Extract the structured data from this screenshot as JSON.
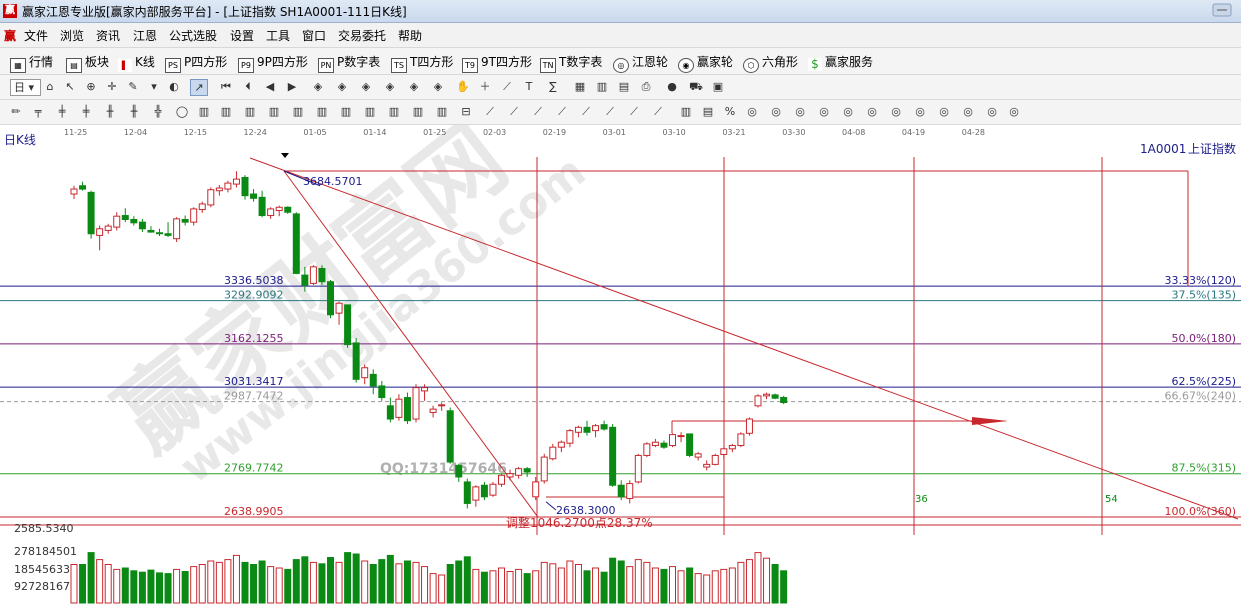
{
  "window": {
    "title": "赢家江恩专业版[赢家内部服务平台] - [上证指数  SH1A0001-111日K线]",
    "app_icon": "赢"
  },
  "menu": [
    "文件",
    "浏览",
    "资讯",
    "江恩",
    "公式选股",
    "设置",
    "工具",
    "窗口",
    "交易委托",
    "帮助"
  ],
  "menu_logo": "赢",
  "toolbar": [
    "行情",
    "板块",
    "K线",
    "P四方形",
    "9P四方形",
    "P数字表",
    "T四方形",
    "9T四方形",
    "T数字表",
    "江恩轮",
    "赢家轮",
    "六角形",
    "赢家服务"
  ],
  "toolbar2_period": "日",
  "chart": {
    "period_label": "日K线",
    "symbol": "1A0001",
    "name": "上证指数",
    "date_ticks": [
      {
        "label": "11-25",
        "i": 0
      },
      {
        "label": "12-04",
        "i": 7
      },
      {
        "label": "12-15",
        "i": 14
      },
      {
        "label": "12-24",
        "i": 21
      },
      {
        "label": "01-05",
        "i": 28
      },
      {
        "label": "01-14",
        "i": 35
      },
      {
        "label": "01-25",
        "i": 42
      },
      {
        "label": "02-03",
        "i": 49
      },
      {
        "label": "02-19",
        "i": 56
      },
      {
        "label": "03-01",
        "i": 63
      },
      {
        "label": "03-10",
        "i": 70
      },
      {
        "label": "03-21",
        "i": 77
      },
      {
        "label": "03-30",
        "i": 84
      },
      {
        "label": "04-08",
        "i": 91
      },
      {
        "label": "04-19",
        "i": 98
      },
      {
        "label": "04-28",
        "i": 105
      }
    ],
    "high_label": "3684.5701",
    "low_label": "2638.3000",
    "retrace_note": "调整1046.2700点28.37%",
    "fib_levels": [
      {
        "price": 3684.5701,
        "left": "",
        "right": "",
        "color": "#c8282d"
      },
      {
        "price": 3336.5038,
        "left": "3336.5038",
        "right": "33.33%(120)",
        "color": "#1c1c8c"
      },
      {
        "price": 3292.9092,
        "left": "3292.9092",
        "right": "37.5%(135)",
        "color": "#2a7a80"
      },
      {
        "price": 3162.1255,
        "left": "3162.1255",
        "right": "50.0%(180)",
        "color": "#7a1f7a"
      },
      {
        "price": 3031.3417,
        "left": "3031.3417",
        "right": "62.5%(225)",
        "color": "#1c1c8c"
      },
      {
        "price": 2987.7472,
        "left": "2987.7472",
        "right": "66.67%(240)",
        "color": "#9a9a9a"
      },
      {
        "price": 2769.7742,
        "left": "2769.7742",
        "right": "87.5%(315)",
        "color": "#2fa02f"
      },
      {
        "price": 2638.9905,
        "left": "2638.9905",
        "right": "100.0%(360)",
        "color": "#c8282d"
      }
    ],
    "time_cycle_labels": [
      "36",
      "54"
    ],
    "volume_labels": [
      "2585.5340",
      "278184501",
      "185456334",
      "92728167"
    ],
    "watermark_main": "赢家财富网",
    "watermark_url": "www.jingjia360.com",
    "watermark_qq": "QQ:1731457646",
    "colors": {
      "up": "#c8282d",
      "down": "#0a8a14",
      "grid": "#c8282d"
    }
  },
  "chart_data": {
    "type": "candlestick",
    "title": "上证指数 SH1A0001 日K线",
    "ylim": [
      2585,
      3720
    ],
    "candles": [
      [
        3615,
        3640,
        3600,
        3630
      ],
      [
        3640,
        3652,
        3625,
        3630
      ],
      [
        3620,
        3625,
        3480,
        3495
      ],
      [
        3490,
        3520,
        3445,
        3510
      ],
      [
        3505,
        3525,
        3495,
        3518
      ],
      [
        3515,
        3560,
        3505,
        3548
      ],
      [
        3550,
        3572,
        3530,
        3538
      ],
      [
        3538,
        3548,
        3520,
        3528
      ],
      [
        3530,
        3540,
        3500,
        3510
      ],
      [
        3505,
        3518,
        3498,
        3500
      ],
      [
        3498,
        3510,
        3488,
        3495
      ],
      [
        3495,
        3530,
        3485,
        3490
      ],
      [
        3480,
        3545,
        3470,
        3540
      ],
      [
        3538,
        3550,
        3520,
        3530
      ],
      [
        3530,
        3575,
        3520,
        3570
      ],
      [
        3568,
        3592,
        3558,
        3585
      ],
      [
        3582,
        3635,
        3575,
        3628
      ],
      [
        3625,
        3642,
        3610,
        3633
      ],
      [
        3630,
        3655,
        3620,
        3648
      ],
      [
        3645,
        3684,
        3635,
        3660
      ],
      [
        3665,
        3672,
        3598,
        3610
      ],
      [
        3615,
        3630,
        3592,
        3602
      ],
      [
        3605,
        3625,
        3545,
        3550
      ],
      [
        3550,
        3575,
        3540,
        3570
      ],
      [
        3565,
        3580,
        3548,
        3575
      ],
      [
        3575,
        3578,
        3555,
        3560
      ],
      [
        3555,
        3560,
        3510,
        3375
      ],
      [
        3370,
        3395,
        3320,
        3340
      ],
      [
        3345,
        3400,
        3340,
        3395
      ],
      [
        3390,
        3400,
        3340,
        3350
      ],
      [
        3350,
        3355,
        3240,
        3250
      ],
      [
        3255,
        3290,
        3220,
        3285
      ],
      [
        3280,
        3280,
        3150,
        3160
      ],
      [
        3165,
        3180,
        3045,
        3055
      ],
      [
        3060,
        3100,
        3040,
        3090
      ],
      [
        3070,
        3085,
        3010,
        3035
      ],
      [
        3035,
        3050,
        2990,
        3000
      ],
      [
        2975,
        3000,
        2925,
        2935
      ],
      [
        2940,
        3010,
        2930,
        2995
      ],
      [
        3000,
        3015,
        2920,
        2930
      ],
      [
        2935,
        3040,
        2925,
        3030
      ],
      [
        3020,
        3040,
        2990,
        3030
      ],
      [
        2955,
        2975,
        2940,
        2965
      ],
      [
        2975,
        2985,
        2960,
        2978
      ],
      [
        2960,
        2970,
        2800,
        2805
      ],
      [
        2795,
        2800,
        2745,
        2760
      ],
      [
        2745,
        2755,
        2665,
        2680
      ],
      [
        2690,
        2735,
        2670,
        2730
      ],
      [
        2735,
        2745,
        2690,
        2700
      ],
      [
        2705,
        2745,
        2700,
        2738
      ],
      [
        2738,
        2770,
        2730,
        2765
      ],
      [
        2760,
        2782,
        2750,
        2770
      ],
      [
        2765,
        2790,
        2755,
        2785
      ],
      [
        2785,
        2790,
        2760,
        2775
      ],
      [
        2700,
        2760,
        2690,
        2745
      ],
      [
        2748,
        2830,
        2740,
        2820
      ],
      [
        2815,
        2860,
        2810,
        2850
      ],
      [
        2850,
        2870,
        2835,
        2865
      ],
      [
        2862,
        2905,
        2850,
        2900
      ],
      [
        2895,
        2915,
        2880,
        2910
      ],
      [
        2910,
        2930,
        2885,
        2895
      ],
      [
        2900,
        2920,
        2880,
        2915
      ],
      [
        2918,
        2930,
        2900,
        2905
      ],
      [
        2910,
        2920,
        2730,
        2735
      ],
      [
        2735,
        2750,
        2690,
        2700
      ],
      [
        2695,
        2750,
        2680,
        2740
      ],
      [
        2745,
        2830,
        2740,
        2825
      ],
      [
        2825,
        2865,
        2820,
        2860
      ],
      [
        2855,
        2875,
        2850,
        2865
      ],
      [
        2862,
        2870,
        2845,
        2850
      ],
      [
        2855,
        2892,
        2850,
        2888
      ],
      [
        2885,
        2895,
        2865,
        2885
      ],
      [
        2890,
        2885,
        2820,
        2825
      ],
      [
        2820,
        2835,
        2810,
        2830
      ],
      [
        2790,
        2810,
        2780,
        2798
      ],
      [
        2798,
        2830,
        2795,
        2825
      ],
      [
        2828,
        2850,
        2815,
        2845
      ],
      [
        2845,
        2860,
        2835,
        2855
      ],
      [
        2855,
        2895,
        2850,
        2890
      ],
      [
        2892,
        2940,
        2885,
        2935
      ],
      [
        2975,
        3010,
        2970,
        3005
      ],
      [
        3005,
        3015,
        2995,
        3010
      ],
      [
        3008,
        3012,
        2995,
        2998
      ],
      [
        3000,
        3005,
        2980,
        2985
      ]
    ],
    "volume_ratio": [
      0.55,
      0.55,
      0.72,
      0.62,
      0.55,
      0.48,
      0.5,
      0.46,
      0.44,
      0.47,
      0.43,
      0.42,
      0.48,
      0.45,
      0.52,
      0.55,
      0.6,
      0.58,
      0.62,
      0.68,
      0.58,
      0.55,
      0.6,
      0.52,
      0.5,
      0.48,
      0.62,
      0.66,
      0.58,
      0.56,
      0.65,
      0.58,
      0.72,
      0.7,
      0.6,
      0.55,
      0.62,
      0.68,
      0.56,
      0.6,
      0.58,
      0.52,
      0.42,
      0.4,
      0.55,
      0.6,
      0.66,
      0.48,
      0.44,
      0.46,
      0.5,
      0.45,
      0.48,
      0.42,
      0.46,
      0.58,
      0.56,
      0.5,
      0.6,
      0.55,
      0.46,
      0.5,
      0.44,
      0.64,
      0.6,
      0.52,
      0.62,
      0.58,
      0.5,
      0.48,
      0.52,
      0.46,
      0.5,
      0.42,
      0.4,
      0.46,
      0.48,
      0.5,
      0.58,
      0.62,
      0.72,
      0.64,
      0.55,
      0.46
    ]
  }
}
